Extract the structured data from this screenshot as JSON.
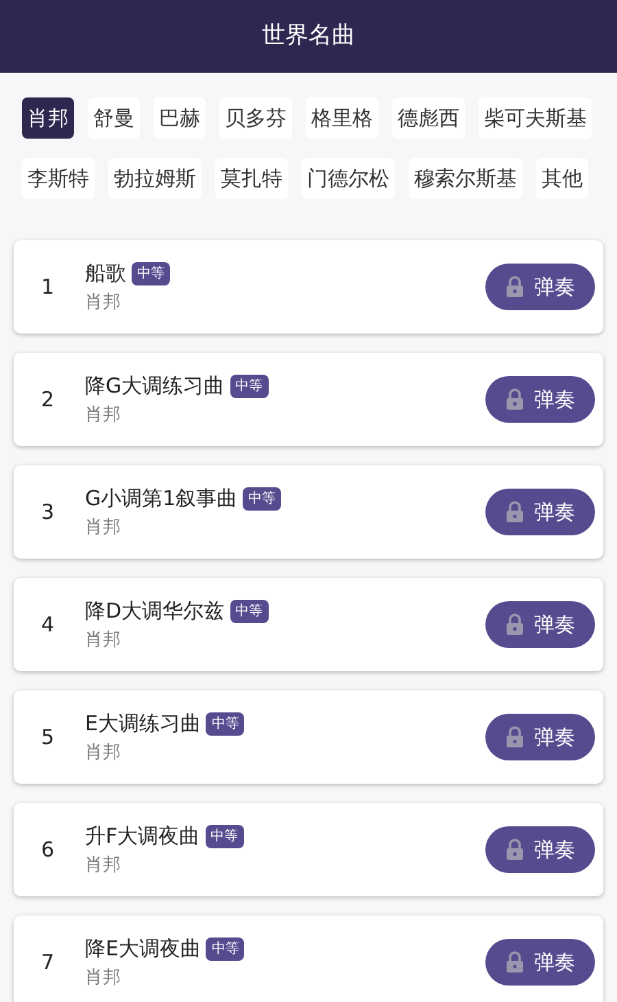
{
  "header": {
    "title": "世界名曲"
  },
  "composers": [
    {
      "label": "肖邦",
      "selected": true
    },
    {
      "label": "舒曼",
      "selected": false
    },
    {
      "label": "巴赫",
      "selected": false
    },
    {
      "label": "贝多芬",
      "selected": false
    },
    {
      "label": "格里格",
      "selected": false
    },
    {
      "label": "德彪西",
      "selected": false
    },
    {
      "label": "柴可夫斯基",
      "selected": false
    },
    {
      "label": "李斯特",
      "selected": false
    },
    {
      "label": "勃拉姆斯",
      "selected": false
    },
    {
      "label": "莫扎特",
      "selected": false
    },
    {
      "label": "门德尔松",
      "selected": false
    },
    {
      "label": "穆索尔斯基",
      "selected": false
    },
    {
      "label": "其他",
      "selected": false
    }
  ],
  "pieces": [
    {
      "number": "1",
      "title": "船歌",
      "level": "中等",
      "composer": "肖邦",
      "button": "弹奏"
    },
    {
      "number": "2",
      "title": "降G大调练习曲",
      "level": "中等",
      "composer": "肖邦",
      "button": "弹奏"
    },
    {
      "number": "3",
      "title": "G小调第1叙事曲",
      "level": "中等",
      "composer": "肖邦",
      "button": "弹奏"
    },
    {
      "number": "4",
      "title": "降D大调华尔兹",
      "level": "中等",
      "composer": "肖邦",
      "button": "弹奏"
    },
    {
      "number": "5",
      "title": "E大调练习曲",
      "level": "中等",
      "composer": "肖邦",
      "button": "弹奏"
    },
    {
      "number": "6",
      "title": "升F大调夜曲",
      "level": "中等",
      "composer": "肖邦",
      "button": "弹奏"
    },
    {
      "number": "7",
      "title": "降E大调夜曲",
      "level": "中等",
      "composer": "肖邦",
      "button": "弹奏"
    }
  ]
}
